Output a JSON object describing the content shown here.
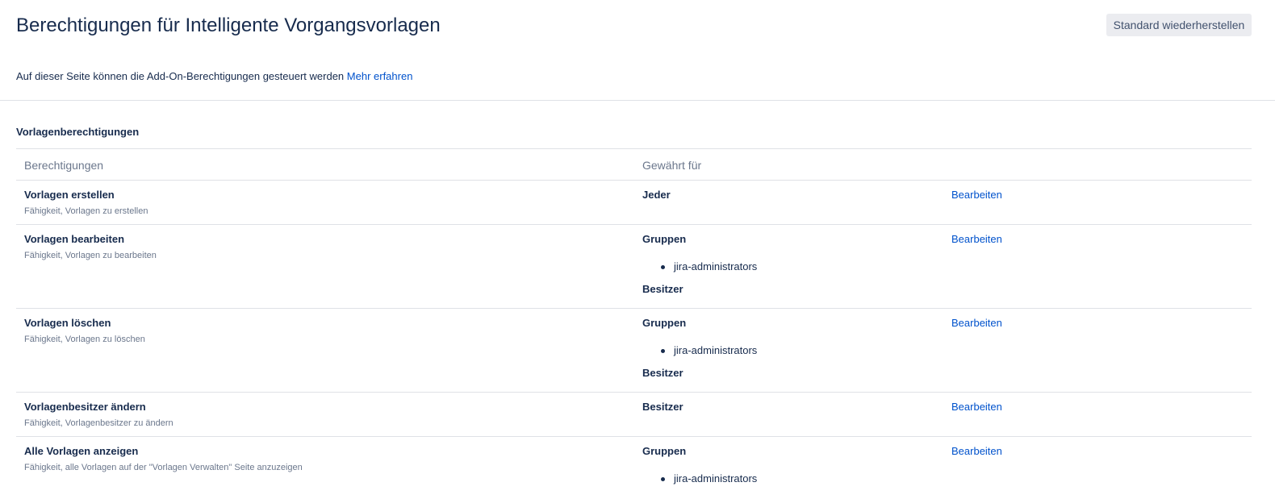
{
  "header": {
    "title": "Berechtigungen für Intelligente Vorgangsvorlagen",
    "restore_label": "Standard wiederherstellen",
    "description": "Auf dieser Seite können die Add-On-Berechtigungen gesteuert werden",
    "learn_more": "Mehr erfahren"
  },
  "section": {
    "title": "Vorlagenberechtigungen",
    "col_permissions": "Berechtigungen",
    "col_granted": "Gewährt für"
  },
  "rows": [
    {
      "name": "Vorlagen erstellen",
      "desc": "Fähigkeit, Vorlagen zu erstellen",
      "grant_label": "Jeder",
      "group": "",
      "owner": "",
      "edit": "Bearbeiten"
    },
    {
      "name": "Vorlagen bearbeiten",
      "desc": "Fähigkeit, Vorlagen zu bearbeiten",
      "grant_label": "Gruppen",
      "group": "jira-administrators",
      "owner": "Besitzer",
      "edit": "Bearbeiten"
    },
    {
      "name": "Vorlagen löschen",
      "desc": "Fähigkeit, Vorlagen zu löschen",
      "grant_label": "Gruppen",
      "group": "jira-administrators",
      "owner": "Besitzer",
      "edit": "Bearbeiten"
    },
    {
      "name": "Vorlagenbesitzer ändern",
      "desc": "Fähigkeit, Vorlagenbesitzer zu ändern",
      "grant_label": "Besitzer",
      "group": "",
      "owner": "",
      "edit": "Bearbeiten"
    },
    {
      "name": "Alle Vorlagen anzeigen",
      "desc": "Fähigkeit, alle Vorlagen auf der \"Vorlagen Verwalten\" Seite anzuzeigen",
      "grant_label": "Gruppen",
      "group": "jira-administrators",
      "owner": "",
      "edit": "Bearbeiten"
    }
  ]
}
